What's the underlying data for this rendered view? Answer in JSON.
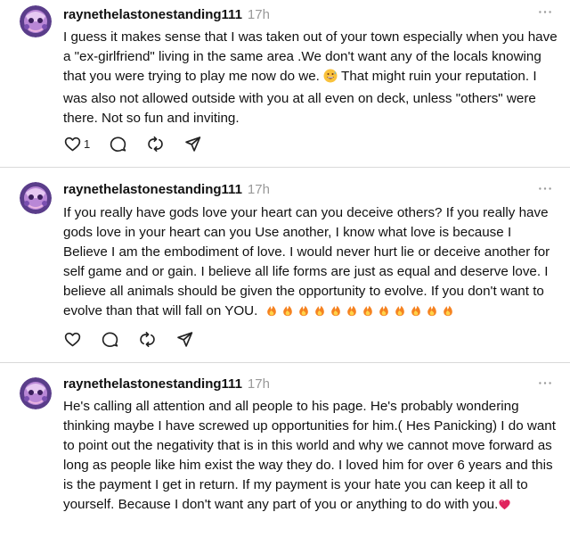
{
  "posts": [
    {
      "username": "raynethelastonestanding111",
      "time": "17h",
      "text_before_emoji": "I guess it makes sense that I was taken out of your town especially when you have a \"ex-girlfriend\" living in the same area .We don't want any of the locals knowing that you were trying to play me now do we.",
      "text_after_emoji": " That might ruin your reputation. I was also not allowed outside with you at all even on deck, unless \"others\" were there. Not so fun and inviting.",
      "like_count": "1"
    },
    {
      "username": "raynethelastonestanding111",
      "time": "17h",
      "text": "If you really have gods love your heart can you deceive others? If you really have gods love in your heart can you Use another, I know what love is because I Believe I am the embodiment of love. I would never hurt lie or deceive another for self game and or gain. I believe all life forms are just as equal and deserve love. I believe all animals should be given the opportunity to evolve. If you don't want to evolve than that will fall on YOU.",
      "fire_emoji_count": 12
    },
    {
      "username": "raynethelastonestanding111",
      "time": "17h",
      "text": "He's calling all attention and all people to his page. He's probably wondering thinking maybe I have screwed up opportunities for him.( Hes Panicking) I do want to point out the negativity that is in this world and why we cannot move forward as long as people like him exist the way they do. I loved him for over 6 years and this is the payment I get in return. If my payment is your hate you can keep it all to yourself. Because I don't want any part of you or anything to do with you."
    }
  ],
  "icons": {
    "like": "heart-icon",
    "reply": "comment-icon",
    "repost": "repost-icon",
    "share": "share-icon",
    "more": "more-icon",
    "emoji_1": "grinning-sweat-emoji",
    "emoji_2": "fire-emoji",
    "emoji_3": "heart-emoji"
  },
  "colors": {
    "text": "#111111",
    "meta": "#999999",
    "divider": "#d9d9d9",
    "fire": "#f58220",
    "heart_emoji": "#e0245e"
  }
}
